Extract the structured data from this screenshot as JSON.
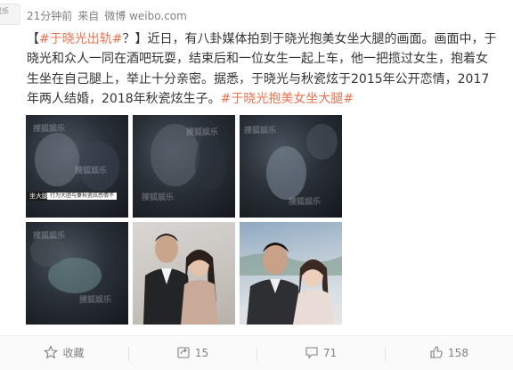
{
  "header": {
    "avatar_text": "娱乐",
    "time": "21分钟前",
    "source_prefix": "来自",
    "source": "微博 weibo.com"
  },
  "post": {
    "hashtag_1": "#于晓光出轨#",
    "text_1": "？】近日，有八卦媒体拍到于晓光抱美女坐大腿的画面。画面中，于晓光和众人一同在酒吧玩耍，结束后和一位女生一起上车，他一把揽过女生，抱着女生坐在自己腿上，举止十分亲密。据悉，于晓光与秋瓷炫于2015年公开恋情，2017年两人结婚，2018年秋瓷炫生子。",
    "hashtag_2": "#于晓光抱美女坐大腿#"
  },
  "photos": {
    "watermark": "搜狐娱乐",
    "caption_1": "坐大腿",
    "caption_2": "行为大胆与妻秋瓷炫感情不"
  },
  "actions": {
    "favorite_label": "收藏",
    "share_count": "15",
    "comment_count": "71",
    "like_count": "158"
  },
  "colors": {
    "accent": "#eb7350",
    "meta": "#808080",
    "body_text": "#333333"
  }
}
